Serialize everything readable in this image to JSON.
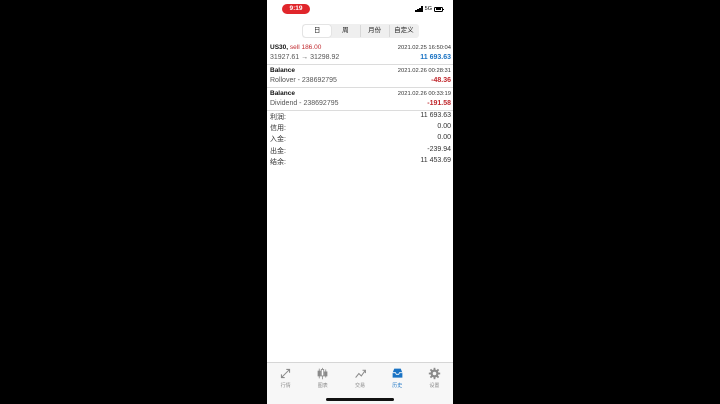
{
  "status": {
    "time": "9:19",
    "network": "5G"
  },
  "segments": [
    {
      "label": "日",
      "active": true
    },
    {
      "label": "周",
      "active": false
    },
    {
      "label": "月份",
      "active": false
    },
    {
      "label": "自定义",
      "active": false
    }
  ],
  "deals": [
    {
      "symbol": "US30,",
      "side": "sell 186.00",
      "date": "2021.02.25 16:50:04",
      "detail": "31927.61 → 31298.92",
      "amount": "11 693.63",
      "sign": "pos"
    },
    {
      "symbol": "Balance",
      "side": "",
      "date": "2021.02.26 00:28:31",
      "detail": "Rollover - 238692795",
      "amount": "-48.36",
      "sign": "neg"
    },
    {
      "symbol": "Balance",
      "side": "",
      "date": "2021.02.26 00:33:19",
      "detail": "Dividend - 238692795",
      "amount": "-191.58",
      "sign": "neg"
    }
  ],
  "summary": [
    {
      "label": "利润:",
      "value": "11 693.63"
    },
    {
      "label": "信用:",
      "value": "0.00"
    },
    {
      "label": "入金:",
      "value": "0.00"
    },
    {
      "label": "出金:",
      "value": "-239.94"
    },
    {
      "label": "结余:",
      "value": "11 453.69"
    }
  ],
  "tabbar": [
    {
      "label": "行情",
      "icon": "quotes-icon",
      "active": false
    },
    {
      "label": "图表",
      "icon": "chart-icon",
      "active": false
    },
    {
      "label": "交易",
      "icon": "trade-icon",
      "active": false
    },
    {
      "label": "历史",
      "icon": "history-icon",
      "active": true
    },
    {
      "label": "设置",
      "icon": "settings-icon",
      "active": false
    }
  ],
  "colors": {
    "accent": "#1a73c4",
    "negative": "#c0282d",
    "time_pill": "#e0262b"
  }
}
